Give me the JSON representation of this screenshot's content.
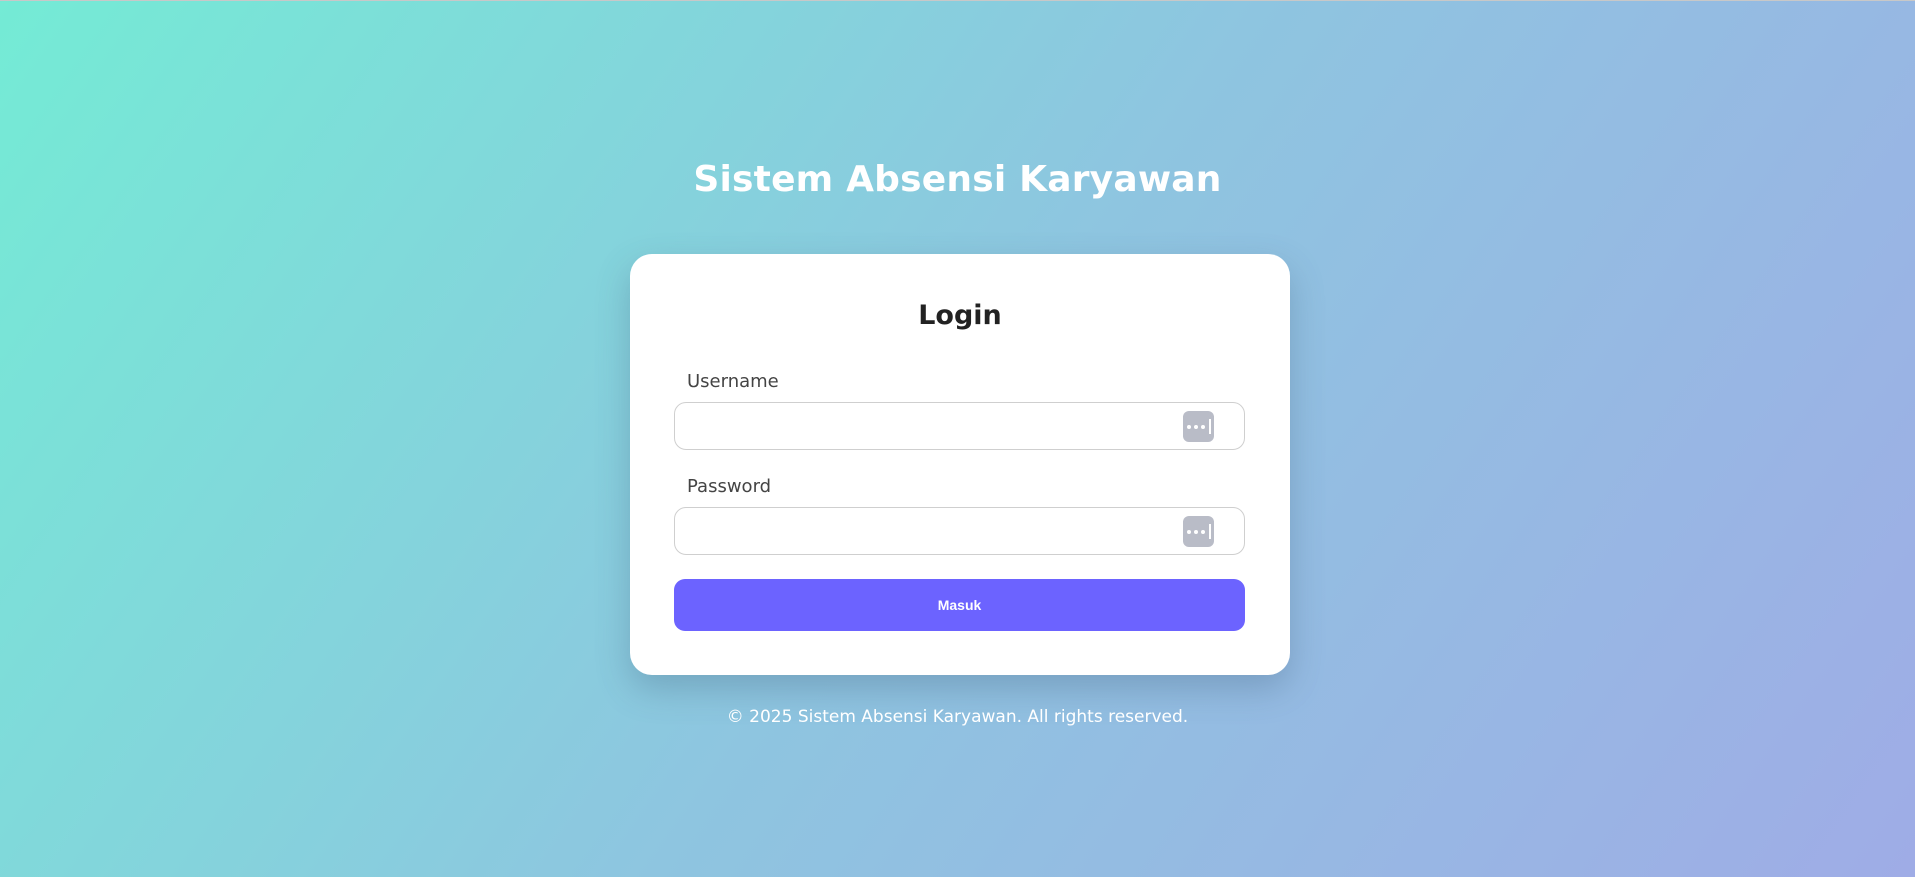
{
  "header": {
    "title": "Sistem Absensi Karyawan"
  },
  "login": {
    "title": "Login",
    "username": {
      "label": "Username",
      "value": "",
      "placeholder": "",
      "icon": "password-manager-icon"
    },
    "password": {
      "label": "Password",
      "value": "",
      "placeholder": "",
      "icon": "password-manager-icon"
    },
    "submit_label": "Masuk"
  },
  "footer": {
    "text": "© 2025 Sistem Absensi Karyawan. All rights reserved."
  },
  "colors": {
    "gradient_start": "#74ebd5",
    "gradient_end": "#9face6",
    "button": "#6c63ff",
    "card": "#ffffff"
  }
}
